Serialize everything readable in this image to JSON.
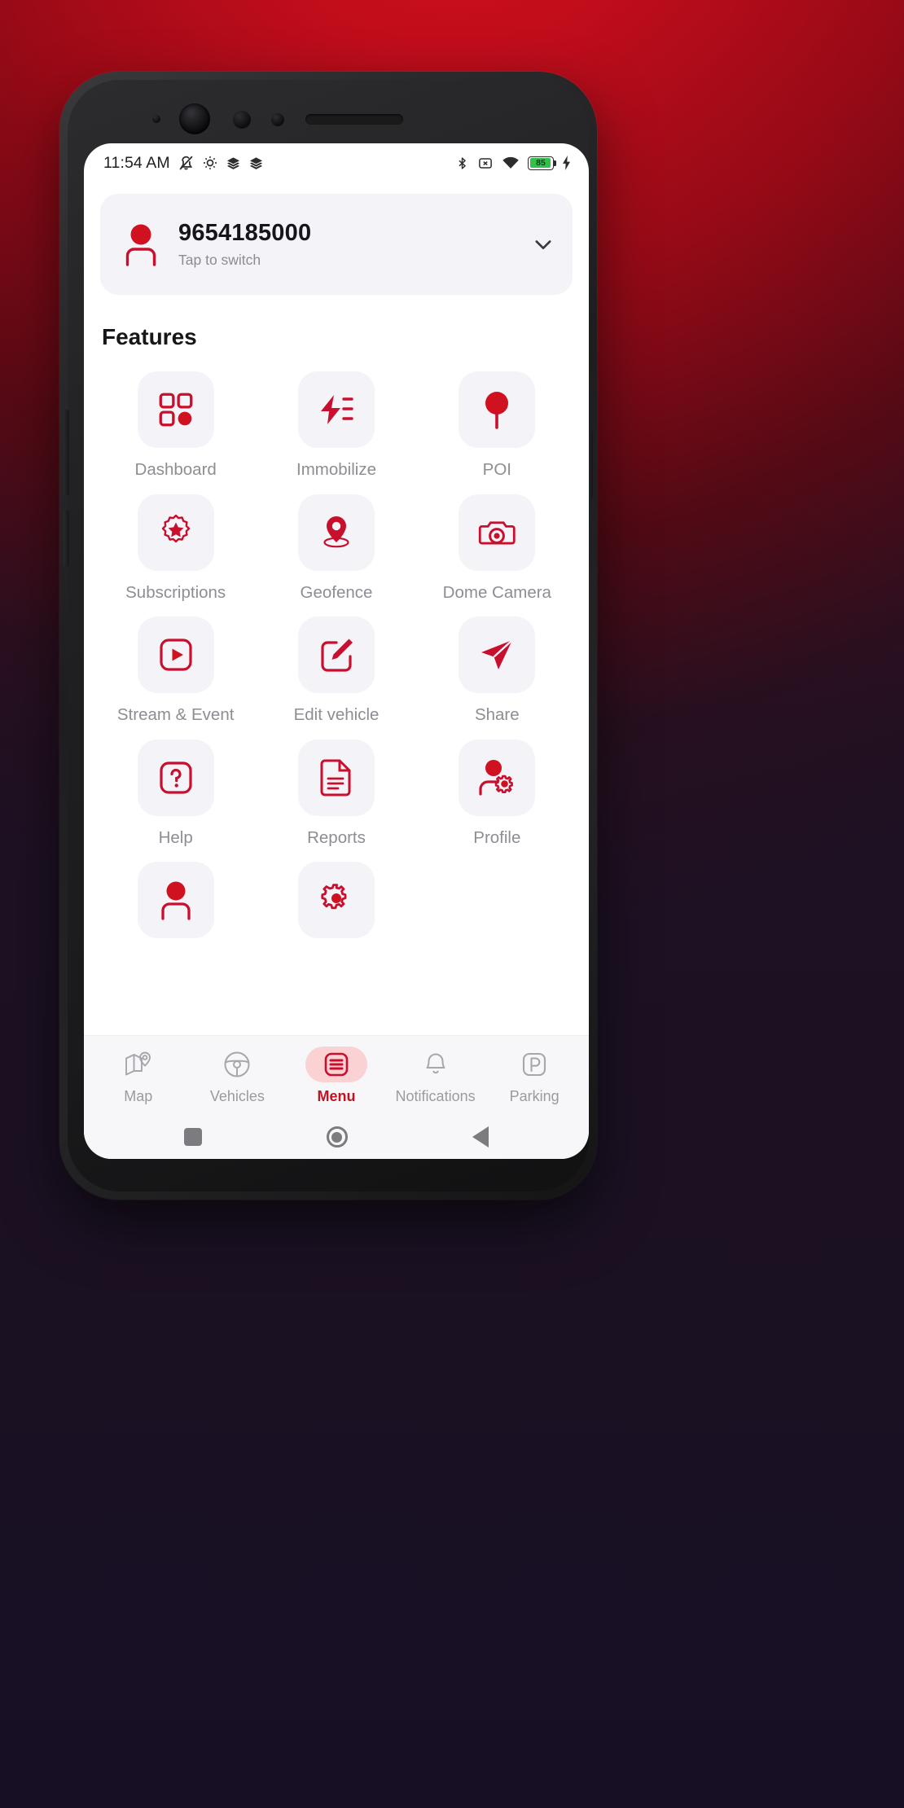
{
  "status_bar": {
    "time": "11:54 AM",
    "left_icons": [
      "mute-bell-icon",
      "android-gear-icon",
      "layers-icon",
      "layers-icon"
    ],
    "right_icons": [
      "bluetooth-icon",
      "sim-off-icon",
      "wifi-icon",
      "battery-icon",
      "charging-bolt-icon"
    ],
    "battery_level": "85"
  },
  "account_card": {
    "icon": "user-avatar-icon",
    "phone": "9654185000",
    "subtitle": "Tap to switch",
    "chevron": "chevron-down-icon"
  },
  "features": {
    "title": "Features",
    "items": [
      {
        "label": "Dashboard",
        "icon": "dashboard-grid-icon"
      },
      {
        "label": "Immobilize",
        "icon": "immobilize-bolt-icon"
      },
      {
        "label": "POI",
        "icon": "poi-pin-icon"
      },
      {
        "label": "Subscriptions",
        "icon": "subscription-badge-star-icon"
      },
      {
        "label": "Geofence",
        "icon": "geofence-pin-icon"
      },
      {
        "label": "Dome Camera",
        "icon": "dome-camera-icon"
      },
      {
        "label": "Stream & Event",
        "icon": "stream-play-icon"
      },
      {
        "label": "Edit vehicle",
        "icon": "edit-pencil-icon"
      },
      {
        "label": "Share",
        "icon": "share-send-icon"
      },
      {
        "label": "Help",
        "icon": "help-question-icon"
      },
      {
        "label": "Reports",
        "icon": "reports-document-icon"
      },
      {
        "label": "Profile",
        "icon": "profile-settings-icon"
      },
      {
        "label": "",
        "icon": "user-avatar-icon"
      },
      {
        "label": "",
        "icon": "settings-gear-user-icon"
      },
      {
        "label": "",
        "icon": ""
      }
    ]
  },
  "tab_bar": {
    "items": [
      {
        "label": "Map",
        "icon": "map-pin-icon",
        "active": false
      },
      {
        "label": "Vehicles",
        "icon": "steering-wheel-icon",
        "active": false
      },
      {
        "label": "Menu",
        "icon": "menu-list-icon",
        "active": true
      },
      {
        "label": "Notifications",
        "icon": "bell-icon",
        "active": false
      },
      {
        "label": "Parking",
        "icon": "parking-p-icon",
        "active": false
      }
    ]
  },
  "android_nav": {
    "recent": "square-recents-icon",
    "home": "circle-home-icon",
    "back": "triangle-back-icon"
  },
  "colors": {
    "brand_red": "#C8102E",
    "accent_pill": "#FBD2D4",
    "tile_bg": "#F4F4F8",
    "label_gray": "#8D8D94"
  }
}
